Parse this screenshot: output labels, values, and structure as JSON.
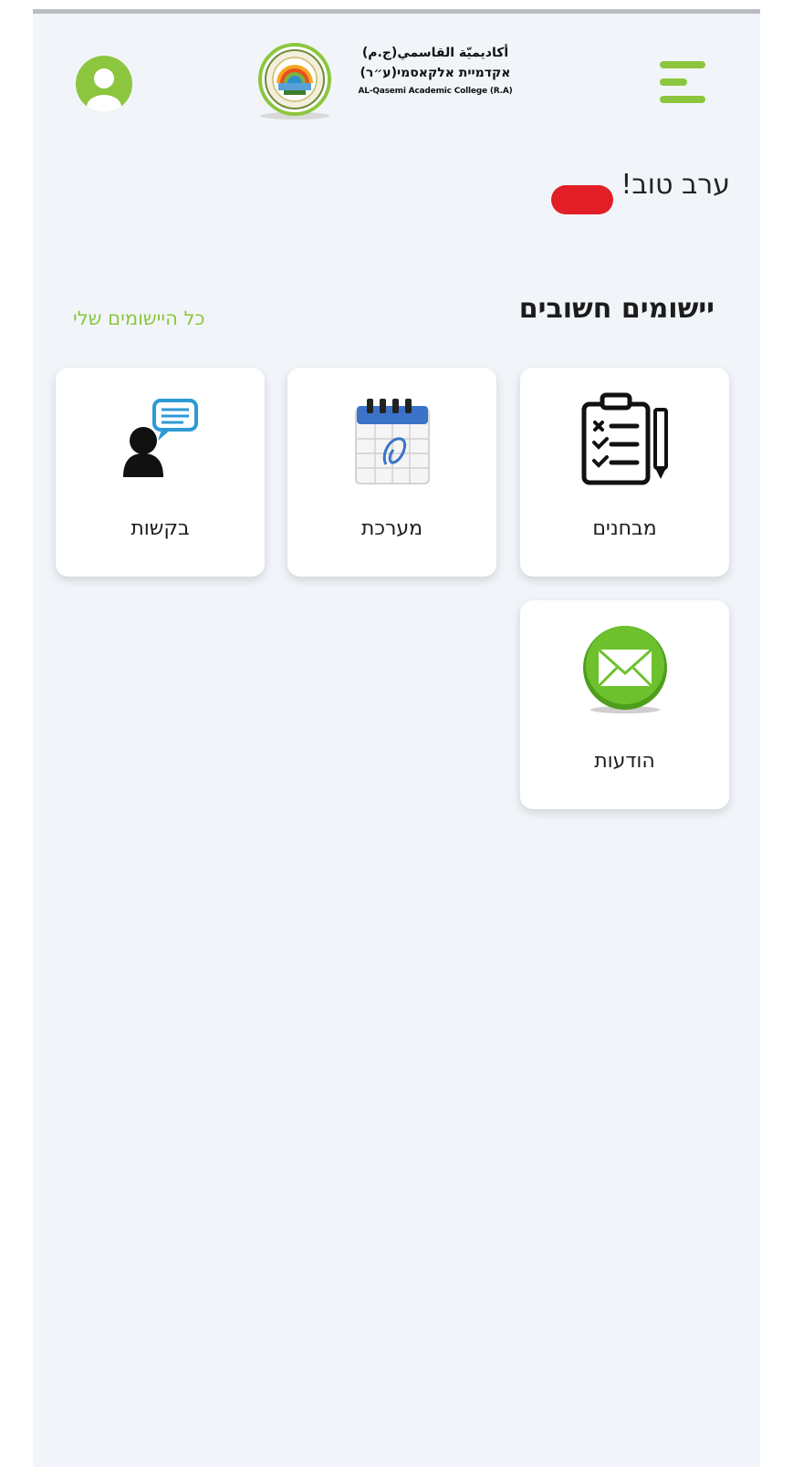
{
  "header": {
    "logo": {
      "line1": "أكاديميّة القاسمي(ج.م)",
      "line2": "אקדמיית אלקאסמי(ע״ר)",
      "line3": "AL-Qasemi Academic College (R.A)"
    },
    "user_icon": "user-circle-icon",
    "menu_icon": "hamburger-menu-icon",
    "accent_color": "#8cc63f"
  },
  "greeting": "ערב טוב!",
  "section": {
    "title": "יישומים חשובים",
    "all_link": "כל היישומים שלי"
  },
  "apps": [
    {
      "label": "מבחנים",
      "icon": "exam-clipboard-icon"
    },
    {
      "label": "מערכת",
      "icon": "calendar-icon"
    },
    {
      "label": "בקשות",
      "icon": "requests-chat-icon"
    },
    {
      "label": "הודעות",
      "icon": "envelope-icon"
    }
  ]
}
